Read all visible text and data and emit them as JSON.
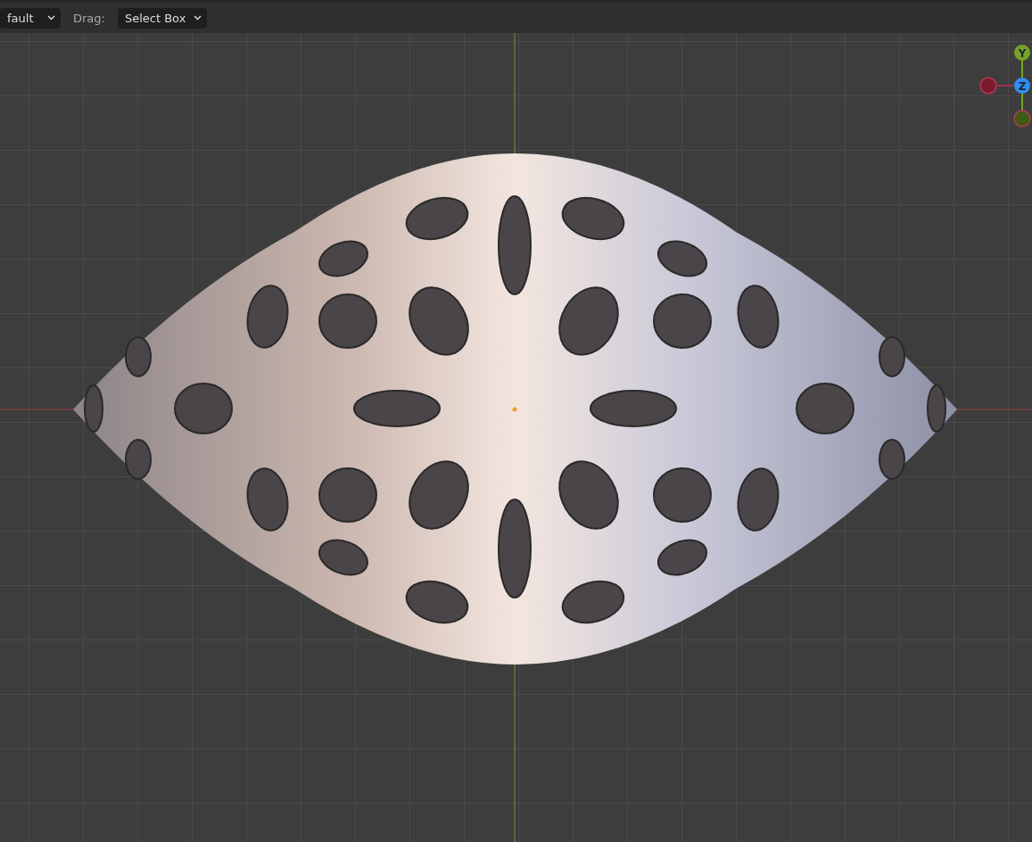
{
  "header": {
    "mode_dropdown": "fault",
    "drag_label": "Drag:",
    "drag_dropdown": "Select Box"
  },
  "gizmo": {
    "axes": [
      {
        "kind": "positive",
        "label": "Y",
        "color": "#76a326"
      },
      {
        "kind": "positive",
        "label": "Z",
        "color": "#2f8ef0"
      },
      {
        "kind": "negative",
        "color": "#7c1a2c"
      },
      {
        "kind": "negative",
        "color": "#3f5a14"
      }
    ]
  }
}
